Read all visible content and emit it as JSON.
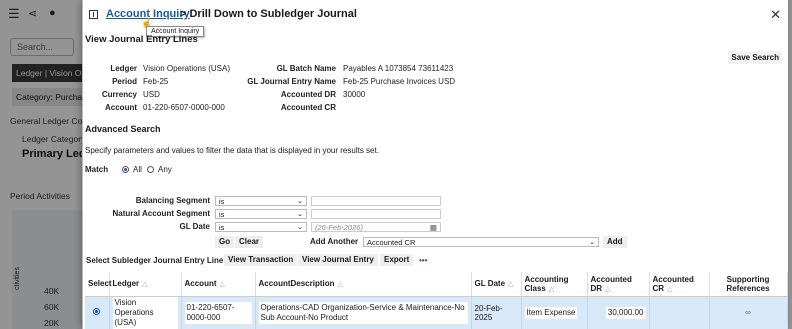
{
  "background": {
    "search_placeholder": "Search...",
    "ledger_chip": "Ledger | Vision Op",
    "category_chip": "Category: Purchas",
    "gl_label": "General Ledger Con",
    "ledger_category": "Ledger Category",
    "primary_ledger": "Primary Ledg",
    "period_activities": "Period Activities",
    "chart_tick_40k": "40K",
    "chart_tick_60k": "60K",
    "chart_tick_20k": "20K",
    "chart_ylabel": "ctivities"
  },
  "dialog": {
    "crumb_link": "Account Inquiry",
    "crumb_rest": "> Drill Down to Subledger Journal",
    "tooltip": "Account Inquiry",
    "section_title": "View Journal Entry Lines",
    "save_search": "Save Search",
    "fields_left": [
      {
        "label": "Ledger",
        "value": "Vision Operations (USA)"
      },
      {
        "label": "Period",
        "value": "Feb-25"
      },
      {
        "label": "Currency",
        "value": "USD"
      },
      {
        "label": "Account",
        "value": "01-220-6507-0000-000"
      }
    ],
    "fields_right": [
      {
        "label": "GL Batch Name",
        "value": "Payables A 1073854 73611423"
      },
      {
        "label": "GL Journal Entry Name",
        "value": "Feb-25 Purchase Invoices USD"
      },
      {
        "label": "Accounted DR",
        "value": "30000"
      },
      {
        "label": "Accounted CR",
        "value": ""
      }
    ],
    "advanced_title": "Advanced Search",
    "advanced_desc": "Specify parameters and values to filter the data that is displayed in your results set.",
    "match_label": "Match",
    "match_all": "All",
    "match_any": "Any",
    "criteria": [
      {
        "label": "Balancing Segment",
        "operator": "is",
        "value": ""
      },
      {
        "label": "Natural Account Segment",
        "operator": "is",
        "value": ""
      },
      {
        "label": "GL Date",
        "operator": "is",
        "value": "(26-Feb-2026)"
      }
    ],
    "go_label": "Go",
    "clear_label": "Clear",
    "add_another_label": "Add Another",
    "add_another_value": "Accounted CR",
    "add_label": "Add",
    "toolbar_label": "Select Subledger Journal Entry Line:",
    "view_transaction": "View Transaction",
    "view_journal_entry": "View Journal Entry",
    "export": "Export",
    "more": "•••"
  },
  "table": {
    "headers": [
      "Select",
      "Ledger",
      "Account",
      "AccountDescription",
      "GL Date",
      "Accounting Class",
      "Accounted DR",
      "Accounted CR",
      "Supporting References"
    ],
    "row": {
      "ledger": "Vision Operations (USA)",
      "account": "01-220-6507-0000-000",
      "description": "Operations-CAD Organization-Service & Maintenance-No Sub Account-No Product",
      "gl_date": "20-Feb-2025",
      "accounting_class": "Item Expense",
      "accounted_dr": "30,000.00",
      "accounted_cr": "",
      "supporting_refs": "∞"
    }
  }
}
